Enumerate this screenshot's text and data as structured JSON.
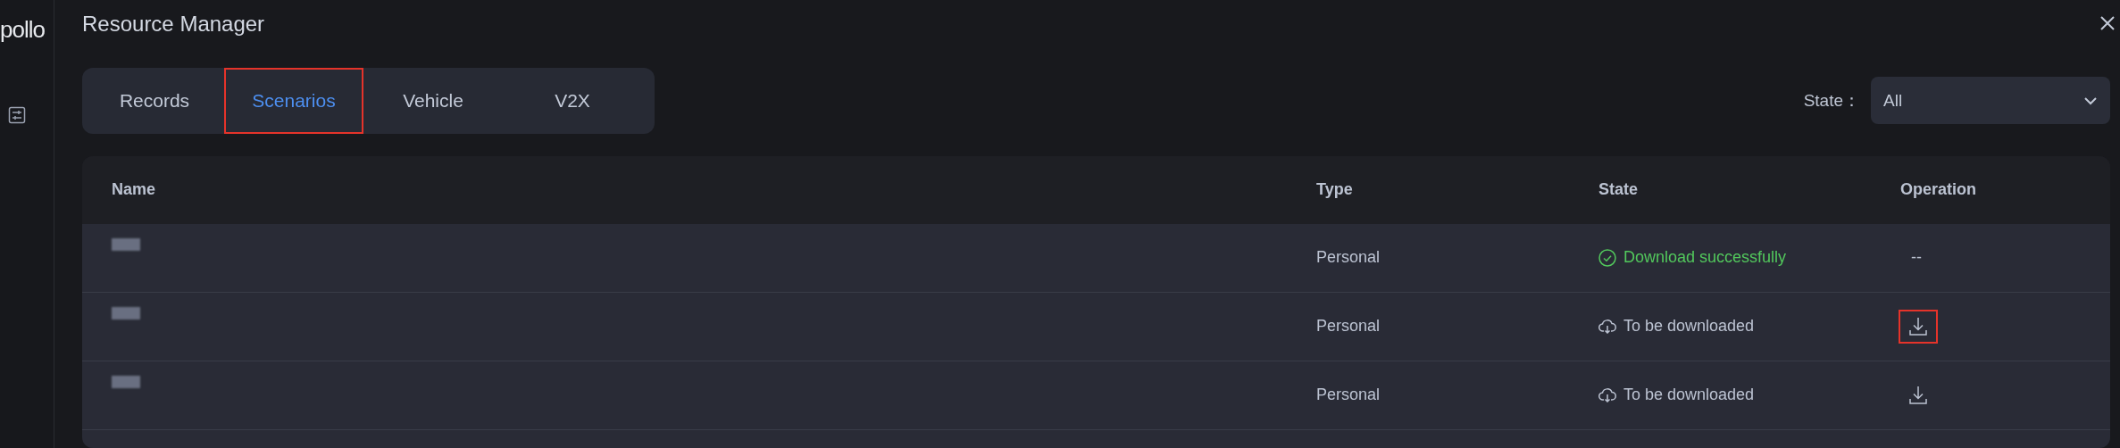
{
  "logo": {
    "text": "pollo"
  },
  "window": {
    "title": "Resource Manager"
  },
  "tabs": [
    {
      "label": "Records",
      "selected": false,
      "highlighted": false
    },
    {
      "label": "Scenarios",
      "selected": true,
      "highlighted": true
    },
    {
      "label": "Vehicle",
      "selected": false,
      "highlighted": false
    },
    {
      "label": "V2X",
      "selected": false,
      "highlighted": false
    }
  ],
  "state_filter": {
    "label": "State：",
    "value": "All"
  },
  "table": {
    "columns": [
      "Name",
      "Type",
      "State",
      "Operation"
    ],
    "rows": [
      {
        "type": "Personal",
        "state": {
          "kind": "done",
          "text": "Download successfully"
        },
        "operation": {
          "kind": "none",
          "text": "--"
        }
      },
      {
        "type": "Personal",
        "state": {
          "kind": "pending",
          "text": "To be downloaded"
        },
        "operation": {
          "kind": "download",
          "highlighted": true
        }
      },
      {
        "type": "Personal",
        "state": {
          "kind": "pending",
          "text": "To be downloaded"
        },
        "operation": {
          "kind": "download",
          "highlighted": false
        }
      }
    ]
  }
}
